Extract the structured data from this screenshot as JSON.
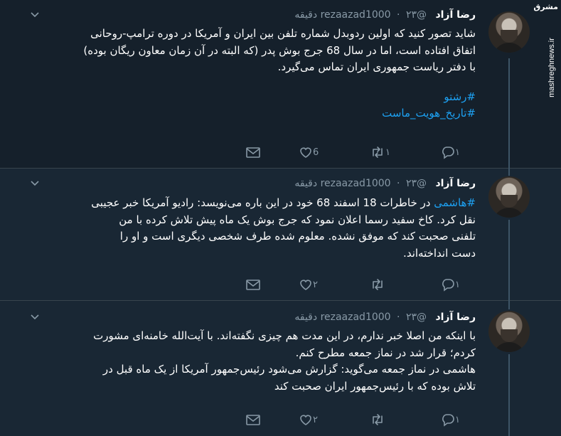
{
  "tweets": [
    {
      "author": "رضا آزاد",
      "handle": "@rezaazad1000",
      "time": "۲۳ دقیقه",
      "lines": [
        "شاید تصور کنید که اولین ردوبدل شماره تلفن بین ایران و آمریکا در دوره ترامپ-روحانی",
        "اتفاق افتاده است، اما در سال 68 جرج بوش پدر (که البته در آن زمان معاون ریگان بوده)",
        "با دفتر ریاست جمهوری ایران تماس می‌گیرد."
      ],
      "hashtags": [
        "#رشتو",
        "#تاریخ_هویت_ماست"
      ],
      "reply_count": "۱",
      "retweet_count": "۱",
      "like_count": "6"
    },
    {
      "author": "رضا آزاد",
      "handle": "@rezaazad1000",
      "time": "۲۳ دقیقه",
      "hashtag": "#هاشمی",
      "lines": [
        " در خاطرات 18 اسفند 68 خود در این باره می‌نویسد: رادیو آمریکا خبر عجیبی",
        "نقل کرد. کاخ سفید رسما اعلان نمود که جرج بوش یک ماه پیش تلاش کرده با من",
        "تلفنی صحبت کند که موفق نشده. معلوم شده طرف شخصی دیگری است و او را",
        "دست انداخته‌اند."
      ],
      "reply_count": "۱",
      "retweet_count": "",
      "like_count": "۲"
    },
    {
      "author": "رضا آزاد",
      "handle": "@rezaazad1000",
      "time": "۲۳ دقیقه",
      "lines": [
        "با اینکه من اصلا خبر ندارم، در این مدت هم چیزی نگفته‌اند. با آیت‌الله خامنه‌ای مشورت",
        "کردم؛ قرار شد در نماز جمعه مطرح کنم.",
        "هاشمی در نماز جمعه می‌گوید: گزارش می‌شود رئیس‌جمهور آمریکا از یک ماه قبل در",
        "تلاش بوده که با رئیس‌جمهور ایران صحبت کند"
      ],
      "reply_count": "۱",
      "retweet_count": "",
      "like_count": "۲"
    }
  ],
  "watermark": {
    "logo_text": "مشرق",
    "site": "mashreghnews.ir"
  },
  "colors": {
    "background": "#15202b",
    "card": "#192734",
    "link": "#1da1f2",
    "muted": "#8899a6"
  }
}
